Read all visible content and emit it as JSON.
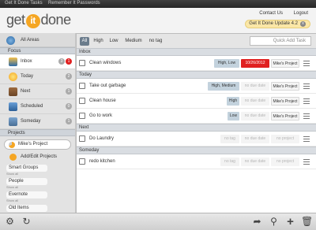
{
  "topbar": {
    "tab1": "Get It Done Tasks",
    "tab2": "Remember It Passwords"
  },
  "header": {
    "logo_pre": "get",
    "logo_it": "it",
    "logo_post": "done",
    "contact": "Contact Us",
    "logout": "Logout",
    "update": "Get It Done Update 4.2",
    "update_close": "x"
  },
  "sidebar": {
    "all_areas": "All Areas",
    "focus_header": "Focus",
    "nav": [
      {
        "label": "Inbox",
        "badge_total": "3",
        "badge_due": "1"
      },
      {
        "label": "Today",
        "badge": "2"
      },
      {
        "label": "Next",
        "badge": "1"
      },
      {
        "label": "Scheduled",
        "badge": "0"
      },
      {
        "label": "Someday",
        "badge": "1"
      }
    ],
    "projects_header": "Projects",
    "project": "Mike's Project",
    "add_projects": "Add/Edit Projects",
    "groups": [
      {
        "title": "Smart Groups",
        "sub": "Show all"
      },
      {
        "title": "People",
        "sub": "Show all"
      },
      {
        "title": "Evernote",
        "sub": "Show all"
      },
      {
        "title": "Old Items",
        "sub": "Show all"
      }
    ]
  },
  "filters": {
    "tabs": [
      "All",
      "High",
      "Low",
      "Medium",
      "no tag"
    ],
    "active": "All",
    "quick_add_placeholder": "Quick Add Task"
  },
  "sections": [
    {
      "title": "Inbox",
      "tasks": [
        {
          "title": "Clean windows",
          "tags": "High, Low",
          "due": "10/26/2012",
          "project": "Mike's Project"
        }
      ]
    },
    {
      "title": "Today",
      "tasks": [
        {
          "title": "Take out garbage",
          "tags": "High, Medium",
          "due": "no due date",
          "project": "Mike's Project"
        },
        {
          "title": "Clean house",
          "tags": "High",
          "due": "no due date",
          "project": "Mike's Project"
        },
        {
          "title": "Go to work",
          "tags": "Low",
          "due": "no due date",
          "project": "Mike's Project"
        }
      ]
    },
    {
      "title": "Next",
      "tasks": [
        {
          "title": "Do Laundry",
          "tags": "no tag",
          "due": "no due date",
          "project": "no project"
        }
      ]
    },
    {
      "title": "Someday",
      "tasks": [
        {
          "title": "redo kitchen",
          "tags": "no tag",
          "due": "no due date",
          "project": "no project"
        }
      ]
    }
  ],
  "colors": {
    "overdue": "#e02020",
    "accent": "#f5a623",
    "tag_chip": "#c3d2dd"
  },
  "toolbar_icons": [
    "gear-icon",
    "refresh-icon",
    "share-icon",
    "search-icon",
    "add-icon",
    "trash-icon"
  ]
}
